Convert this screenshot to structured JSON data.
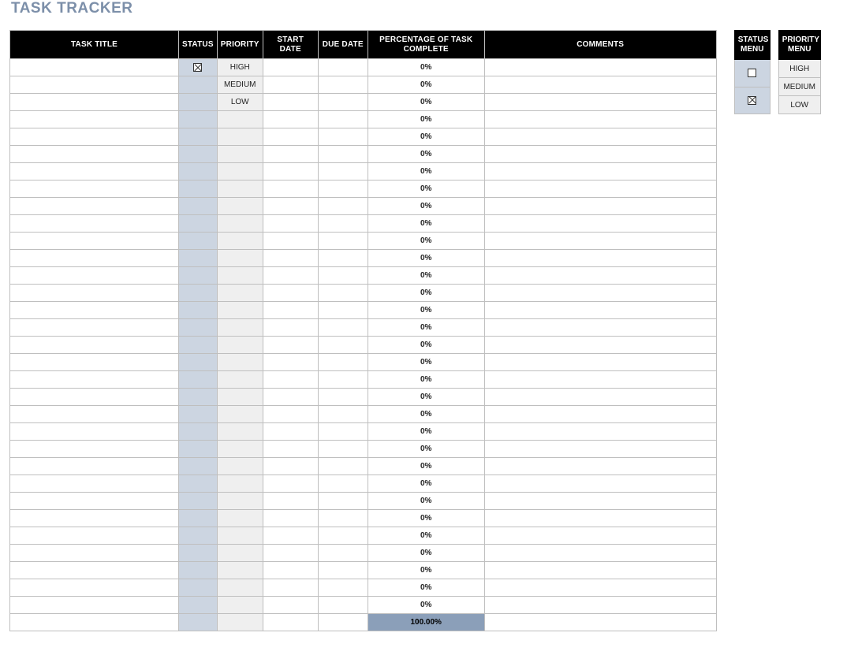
{
  "title": "TASK TRACKER",
  "columns": {
    "task_title": "TASK TITLE",
    "status": "STATUS",
    "priority": "PRIORITY",
    "start_date": "START DATE",
    "due_date": "DUE DATE",
    "pct_complete": "PERCENTAGE OF TASK COMPLETE",
    "comments": "COMMENTS"
  },
  "rows": [
    {
      "title": "",
      "status_checked": true,
      "priority": "HIGH",
      "start": "",
      "due": "",
      "pct": "0%",
      "comments": ""
    },
    {
      "title": "",
      "status_checked": null,
      "priority": "MEDIUM",
      "start": "",
      "due": "",
      "pct": "0%",
      "comments": ""
    },
    {
      "title": "",
      "status_checked": null,
      "priority": "LOW",
      "start": "",
      "due": "",
      "pct": "0%",
      "comments": ""
    },
    {
      "title": "",
      "status_checked": null,
      "priority": "",
      "start": "",
      "due": "",
      "pct": "0%",
      "comments": ""
    },
    {
      "title": "",
      "status_checked": null,
      "priority": "",
      "start": "",
      "due": "",
      "pct": "0%",
      "comments": ""
    },
    {
      "title": "",
      "status_checked": null,
      "priority": "",
      "start": "",
      "due": "",
      "pct": "0%",
      "comments": ""
    },
    {
      "title": "",
      "status_checked": null,
      "priority": "",
      "start": "",
      "due": "",
      "pct": "0%",
      "comments": ""
    },
    {
      "title": "",
      "status_checked": null,
      "priority": "",
      "start": "",
      "due": "",
      "pct": "0%",
      "comments": ""
    },
    {
      "title": "",
      "status_checked": null,
      "priority": "",
      "start": "",
      "due": "",
      "pct": "0%",
      "comments": ""
    },
    {
      "title": "",
      "status_checked": null,
      "priority": "",
      "start": "",
      "due": "",
      "pct": "0%",
      "comments": ""
    },
    {
      "title": "",
      "status_checked": null,
      "priority": "",
      "start": "",
      "due": "",
      "pct": "0%",
      "comments": ""
    },
    {
      "title": "",
      "status_checked": null,
      "priority": "",
      "start": "",
      "due": "",
      "pct": "0%",
      "comments": ""
    },
    {
      "title": "",
      "status_checked": null,
      "priority": "",
      "start": "",
      "due": "",
      "pct": "0%",
      "comments": ""
    },
    {
      "title": "",
      "status_checked": null,
      "priority": "",
      "start": "",
      "due": "",
      "pct": "0%",
      "comments": ""
    },
    {
      "title": "",
      "status_checked": null,
      "priority": "",
      "start": "",
      "due": "",
      "pct": "0%",
      "comments": ""
    },
    {
      "title": "",
      "status_checked": null,
      "priority": "",
      "start": "",
      "due": "",
      "pct": "0%",
      "comments": ""
    },
    {
      "title": "",
      "status_checked": null,
      "priority": "",
      "start": "",
      "due": "",
      "pct": "0%",
      "comments": ""
    },
    {
      "title": "",
      "status_checked": null,
      "priority": "",
      "start": "",
      "due": "",
      "pct": "0%",
      "comments": ""
    },
    {
      "title": "",
      "status_checked": null,
      "priority": "",
      "start": "",
      "due": "",
      "pct": "0%",
      "comments": ""
    },
    {
      "title": "",
      "status_checked": null,
      "priority": "",
      "start": "",
      "due": "",
      "pct": "0%",
      "comments": ""
    },
    {
      "title": "",
      "status_checked": null,
      "priority": "",
      "start": "",
      "due": "",
      "pct": "0%",
      "comments": ""
    },
    {
      "title": "",
      "status_checked": null,
      "priority": "",
      "start": "",
      "due": "",
      "pct": "0%",
      "comments": ""
    },
    {
      "title": "",
      "status_checked": null,
      "priority": "",
      "start": "",
      "due": "",
      "pct": "0%",
      "comments": ""
    },
    {
      "title": "",
      "status_checked": null,
      "priority": "",
      "start": "",
      "due": "",
      "pct": "0%",
      "comments": ""
    },
    {
      "title": "",
      "status_checked": null,
      "priority": "",
      "start": "",
      "due": "",
      "pct": "0%",
      "comments": ""
    },
    {
      "title": "",
      "status_checked": null,
      "priority": "",
      "start": "",
      "due": "",
      "pct": "0%",
      "comments": ""
    },
    {
      "title": "",
      "status_checked": null,
      "priority": "",
      "start": "",
      "due": "",
      "pct": "0%",
      "comments": ""
    },
    {
      "title": "",
      "status_checked": null,
      "priority": "",
      "start": "",
      "due": "",
      "pct": "0%",
      "comments": ""
    },
    {
      "title": "",
      "status_checked": null,
      "priority": "",
      "start": "",
      "due": "",
      "pct": "0%",
      "comments": ""
    },
    {
      "title": "",
      "status_checked": null,
      "priority": "",
      "start": "",
      "due": "",
      "pct": "0%",
      "comments": ""
    },
    {
      "title": "",
      "status_checked": null,
      "priority": "",
      "start": "",
      "due": "",
      "pct": "0%",
      "comments": ""
    },
    {
      "title": "",
      "status_checked": null,
      "priority": "",
      "start": "",
      "due": "",
      "pct": "0%",
      "comments": ""
    }
  ],
  "total_pct": "100.00%",
  "status_menu": {
    "header": "STATUS MENU",
    "items": [
      {
        "checked": false
      },
      {
        "checked": true
      }
    ]
  },
  "priority_menu": {
    "header": "PRIORITY MENU",
    "items": [
      "HIGH",
      "MEDIUM",
      "LOW"
    ]
  }
}
